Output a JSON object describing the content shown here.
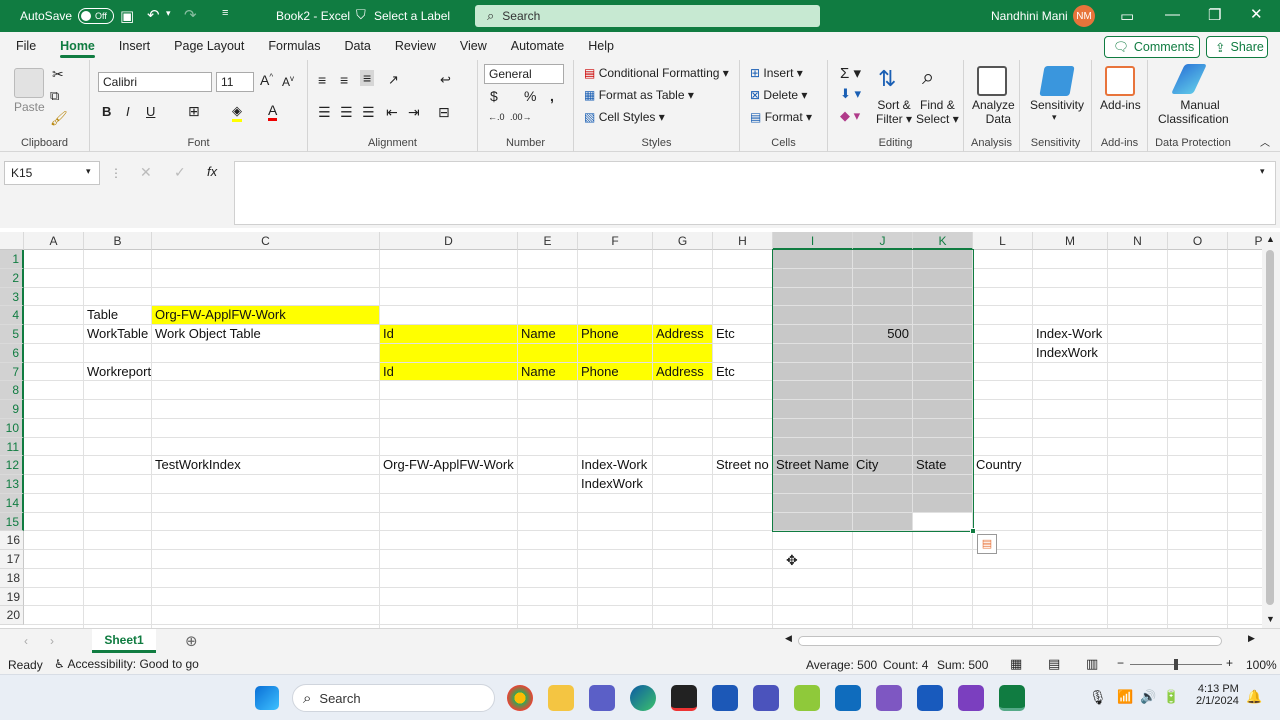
{
  "titlebar": {
    "autosave_label": "AutoSave",
    "autosave_state": "Off",
    "doc_title": "Book2 - Excel",
    "label_button": "Select a Label",
    "search_placeholder": "Search",
    "user_name": "Nandhini Mani",
    "user_initials": "NM"
  },
  "menu": [
    "File",
    "Home",
    "Insert",
    "Page Layout",
    "Formulas",
    "Data",
    "Review",
    "View",
    "Automate",
    "Help"
  ],
  "comments_label": "Comments",
  "share_label": "Share",
  "ribbon": {
    "paste": "Paste",
    "font_name": "Calibri",
    "font_size": "11",
    "number_format": "General",
    "conditional_formatting": "Conditional Formatting",
    "format_as_table": "Format as Table",
    "cell_styles": "Cell Styles",
    "insert": "Insert",
    "delete": "Delete",
    "format": "Format",
    "sort_filter_1": "Sort &",
    "sort_filter_2": "Filter",
    "find_select_1": "Find &",
    "find_select_2": "Select",
    "analyze_1": "Analyze",
    "analyze_2": "Data",
    "sensitivity": "Sensitivity",
    "addins": "Add-ins",
    "manual_1": "Manual",
    "manual_2": "Classification",
    "groups": {
      "clipboard": "Clipboard",
      "font": "Font",
      "alignment": "Alignment",
      "number": "Number",
      "styles": "Styles",
      "cells": "Cells",
      "editing": "Editing",
      "analysis": "Analysis",
      "sensitivity": "Sensitivity",
      "addins": "Add-ins",
      "data_protection": "Data Protection"
    }
  },
  "formula_bar": {
    "name_box": "K15",
    "fx": "fx",
    "value": ""
  },
  "columns": [
    "A",
    "B",
    "C",
    "D",
    "E",
    "F",
    "G",
    "H",
    "I",
    "J",
    "K",
    "L",
    "M",
    "N",
    "O",
    "P"
  ],
  "rows": [
    "1",
    "2",
    "3",
    "4",
    "5",
    "6",
    "7",
    "8",
    "9",
    "10",
    "11",
    "12",
    "13",
    "14",
    "15",
    "16",
    "17",
    "18",
    "19",
    "20"
  ],
  "cells": {
    "B4": "Table",
    "C4": "Org-FW-ApplFW-Work",
    "B5": "WorkTable",
    "C5": "Work Object Table",
    "D5": "Id",
    "E5": "Name",
    "F5": "Phone",
    "G5": "Address",
    "H5": "Etc",
    "J5": "500",
    "M5": "Index-Work",
    "M6": "IndexWork",
    "B7": "Workreport",
    "D7": "Id",
    "E7": "Name",
    "F7": "Phone",
    "G7": "Address",
    "H7": "Etc",
    "C12": "TestWorkIndex",
    "D12": "Org-FW-ApplFW-Work",
    "F12": "Index-Work",
    "H12": "Street no",
    "I12": "Street Name",
    "J12": "City",
    "K12": "State",
    "L12": "Country",
    "F13": "IndexWork"
  },
  "sheet_tab": "Sheet1",
  "status": {
    "ready": "Ready",
    "accessibility": "Accessibility: Good to go",
    "average": "Average: 500",
    "count": "Count: 4",
    "sum": "Sum: 500",
    "zoom": "100%"
  },
  "taskbar": {
    "search": "Search",
    "time": "4:13 PM",
    "date": "2/1/2024"
  },
  "colors": {
    "excel_green": "#107c41",
    "highlight_yellow": "#ffff00",
    "selection_gray": "#c8c8c8"
  }
}
